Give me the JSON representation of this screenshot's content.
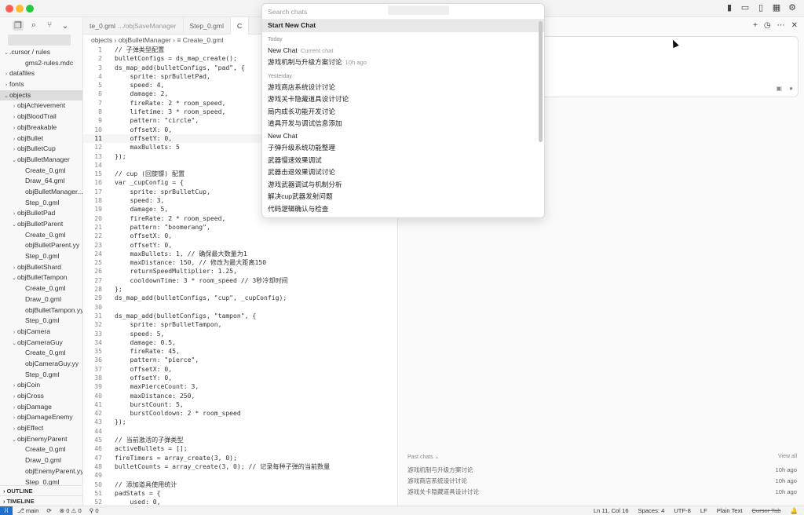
{
  "sidebar": {
    "tree": [
      {
        "label": ".cursor / rules",
        "level": 0,
        "chevron": "v"
      },
      {
        "label": "gms2-rules.mdc",
        "level": 2,
        "chevron": ""
      },
      {
        "label": "datafiles",
        "level": 0,
        "chevron": ">"
      },
      {
        "label": "fonts",
        "level": 0,
        "chevron": ">"
      },
      {
        "label": "objects",
        "level": 0,
        "chevron": "v",
        "selected": true
      },
      {
        "label": "objAchievement",
        "level": 1,
        "chevron": ">"
      },
      {
        "label": "objBloodTrail",
        "level": 1,
        "chevron": ">"
      },
      {
        "label": "objBreakable",
        "level": 1,
        "chevron": ">"
      },
      {
        "label": "objBullet",
        "level": 1,
        "chevron": ">"
      },
      {
        "label": "objBulletCup",
        "level": 1,
        "chevron": ">"
      },
      {
        "label": "objBulletManager",
        "level": 1,
        "chevron": "v"
      },
      {
        "label": "Create_0.gml",
        "level": 2,
        "chevron": ""
      },
      {
        "label": "Draw_64.gml",
        "level": 2,
        "chevron": ""
      },
      {
        "label": "objBulletManager...",
        "level": 2,
        "chevron": ""
      },
      {
        "label": "Step_0.gml",
        "level": 2,
        "chevron": ""
      },
      {
        "label": "objBulletPad",
        "level": 1,
        "chevron": ">"
      },
      {
        "label": "objBulletParent",
        "level": 1,
        "chevron": "v"
      },
      {
        "label": "Create_0.gml",
        "level": 2,
        "chevron": ""
      },
      {
        "label": "objBulletParent.yy",
        "level": 2,
        "chevron": ""
      },
      {
        "label": "Step_0.gml",
        "level": 2,
        "chevron": ""
      },
      {
        "label": "objBulletShard",
        "level": 1,
        "chevron": ">"
      },
      {
        "label": "objBulletTampon",
        "level": 1,
        "chevron": "v"
      },
      {
        "label": "Create_0.gml",
        "level": 2,
        "chevron": ""
      },
      {
        "label": "Draw_0.gml",
        "level": 2,
        "chevron": ""
      },
      {
        "label": "objBulletTampon.yy",
        "level": 2,
        "chevron": ""
      },
      {
        "label": "Step_0.gml",
        "level": 2,
        "chevron": ""
      },
      {
        "label": "objCamera",
        "level": 1,
        "chevron": ">"
      },
      {
        "label": "objCameraGuy",
        "level": 1,
        "chevron": "v"
      },
      {
        "label": "Create_0.gml",
        "level": 2,
        "chevron": ""
      },
      {
        "label": "objCameraGuy.yy",
        "level": 2,
        "chevron": ""
      },
      {
        "label": "Step_0.gml",
        "level": 2,
        "chevron": ""
      },
      {
        "label": "objCoin",
        "level": 1,
        "chevron": ">"
      },
      {
        "label": "objCross",
        "level": 1,
        "chevron": ">"
      },
      {
        "label": "objDamage",
        "level": 1,
        "chevron": ">"
      },
      {
        "label": "objDamageEnemy",
        "level": 1,
        "chevron": ">"
      },
      {
        "label": "objEffect",
        "level": 1,
        "chevron": ">"
      },
      {
        "label": "objEnemyParent",
        "level": 1,
        "chevron": "v"
      },
      {
        "label": "Create_0.gml",
        "level": 2,
        "chevron": ""
      },
      {
        "label": "Draw_0.gml",
        "level": 2,
        "chevron": ""
      },
      {
        "label": "objEnemyParent.yy",
        "level": 2,
        "chevron": ""
      },
      {
        "label": "Step_0.gml",
        "level": 2,
        "chevron": ""
      }
    ],
    "outline_label": "OUTLINE",
    "timeline_label": "TIMELINE"
  },
  "editor": {
    "tabs": [
      {
        "label": "te_0.gml",
        "dim": ".../objSaveManager",
        "active": false
      },
      {
        "label": "Step_0.gml",
        "dim": "",
        "active": false
      },
      {
        "label": "C",
        "dim": "",
        "active": true
      }
    ],
    "breadcrumb": "objects › objBulletManager › ≡ Create_0.gml",
    "current_line": 11,
    "lines": [
      "// 子弹类型配置",
      "bulletConfigs = ds_map_create();",
      "ds_map_add(bulletConfigs, \"pad\", {",
      "    sprite: sprBulletPad,",
      "    speed: 4,",
      "    damage: 2,",
      "    fireRate: 2 * room_speed,",
      "    lifetime: 3 * room_speed,",
      "    pattern: \"circle\",",
      "    offsetX: 0,",
      "    offsetY: 0,",
      "    maxBullets: 5",
      "});",
      "",
      "// cup (回旋镖) 配置",
      "var _cupConfig = {",
      "    sprite: sprBulletCup,",
      "    speed: 3,",
      "    damage: 5,",
      "    fireRate: 2 * room_speed,",
      "    pattern: \"boomerang\",",
      "    offsetX: 0,",
      "    offsetY: 0,",
      "    maxBullets: 1, // 确保最大数量为1",
      "    maxDistance: 150, // 修改为最大距离150",
      "    returnSpeedMultiplier: 1.25,",
      "    cooldownTime: 3 * room_speed // 3秒冷却时间",
      "};",
      "ds_map_add(bulletConfigs, \"cup\", _cupConfig);",
      "",
      "ds_map_add(bulletConfigs, \"tampon\", {",
      "    sprite: sprBulletTampon,",
      "    speed: 5,",
      "    damage: 0.5,",
      "    fireRate: 45,",
      "    pattern: \"pierce\",",
      "    offsetX: 0,",
      "    offsetY: 0,",
      "    maxPierceCount: 3,",
      "    maxDistance: 250,",
      "    burstCount: 5,",
      "    burstCooldown: 2 * room_speed",
      "});",
      "",
      "// 当前激活的子弹类型",
      "activeBullets = [];",
      "fireTimers = array_create(3, 0);",
      "bulletCounts = array_create(3, 0); // 记录每种子弹的当前数量",
      "",
      "// 添加道具使用统计",
      "padStats = {",
      "    used: 0,"
    ]
  },
  "chat_dropdown": {
    "search_placeholder": "Search chats",
    "start_new_label": "Start New Chat",
    "groups": [
      {
        "title": "Today",
        "items": [
          {
            "label": "New Chat",
            "meta": "Current chat"
          },
          {
            "label": "游戏机制与升级方案讨论",
            "meta": "10h ago"
          }
        ]
      },
      {
        "title": "Yesterday",
        "items": [
          {
            "label": "游戏商店系统设计讨论",
            "meta": ""
          },
          {
            "label": "游戏关卡隐藏道具设计讨论",
            "meta": ""
          },
          {
            "label": "局内成长功能开发讨论",
            "meta": ""
          },
          {
            "label": "道具开发与调试信息添加",
            "meta": ""
          },
          {
            "label": "New Chat",
            "meta": ""
          },
          {
            "label": "子弹升级系统功能整理",
            "meta": ""
          },
          {
            "label": "武器慢速效果调试",
            "meta": ""
          },
          {
            "label": "武器击退效果调试讨论",
            "meta": ""
          },
          {
            "label": "游戏武器调试与机制分析",
            "meta": ""
          },
          {
            "label": "解决cup武器发射问题",
            "meta": ""
          },
          {
            "label": "代码逻辑确认与检查",
            "meta": ""
          }
        ]
      }
    ]
  },
  "right_panel": {
    "past_chats_label": "Past chats",
    "view_all_label": "View all",
    "past_chats": [
      {
        "label": "游戏机制与升级方案讨论",
        "time": "10h ago"
      },
      {
        "label": "游戏商店系统设计讨论",
        "time": "10h ago"
      },
      {
        "label": "游戏关卡隐藏道具设计讨论",
        "time": "10h ago"
      }
    ]
  },
  "statusbar": {
    "branch": "main",
    "problems": "⊗ 0 ⚠ 0",
    "ports": "⚲ 0",
    "position": "Ln 11, Col 16",
    "spaces": "Spaces: 4",
    "encoding": "UTF-8",
    "eol": "LF",
    "language": "Plain Text",
    "cursor_tab": "Cursor Tab"
  }
}
